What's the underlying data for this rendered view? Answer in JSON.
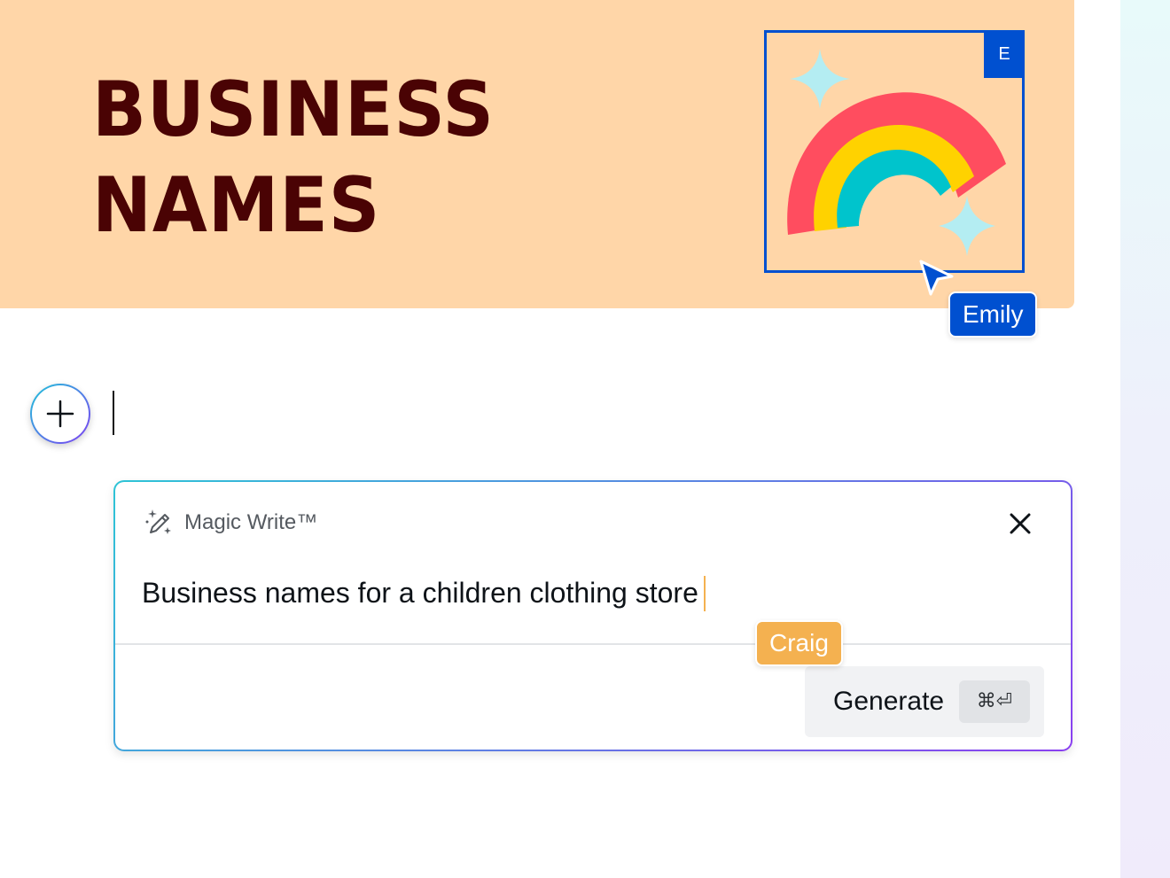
{
  "banner": {
    "title": "BUSINESS\nNAMES",
    "background_color": "#ffd6a8",
    "title_color": "#4a0304"
  },
  "graphic": {
    "icon": "rainbow-with-sparkles",
    "collaborator_badge": "E",
    "selection_color": "#0050d0"
  },
  "collaborators": {
    "emily": {
      "name": "Emily",
      "color": "#0050d0"
    },
    "craig": {
      "name": "Craig",
      "color": "#f4b150"
    }
  },
  "editor": {
    "add_button_icon": "plus-icon"
  },
  "magic_write": {
    "title": "Magic Write™",
    "title_icon": "magic-pencil-sparkle-icon",
    "close_icon": "close-icon",
    "prompt": "Business names for a children clothing store",
    "generate_label": "Generate",
    "shortcut": "⌘⏎"
  },
  "colors": {
    "panel_gradient_start": "#2ec4d6",
    "panel_gradient_end": "#8a3ff0"
  }
}
